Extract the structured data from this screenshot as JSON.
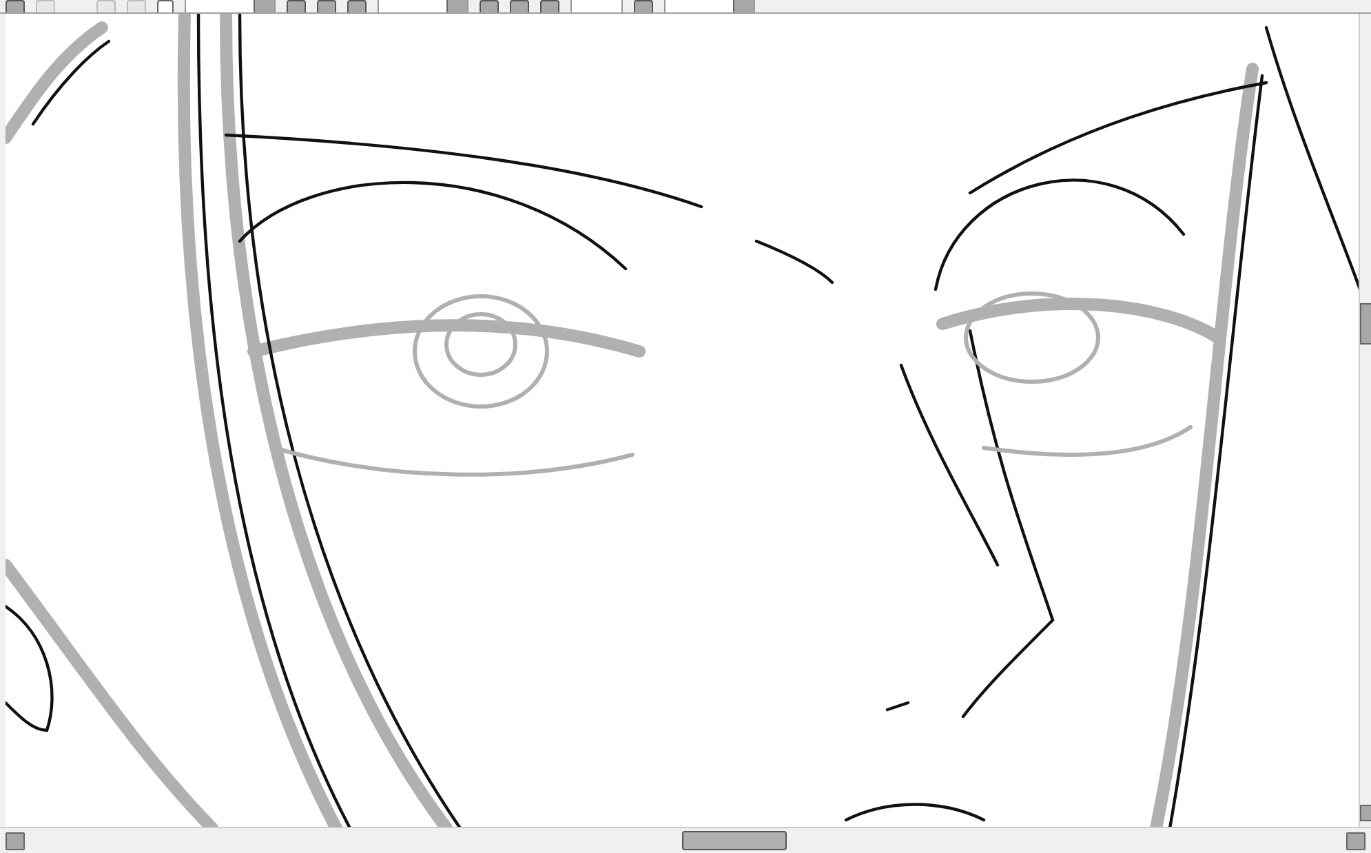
{
  "toolbar": {
    "controls": [
      {
        "kind": "button",
        "disabled": false
      },
      {
        "kind": "button",
        "disabled": true
      },
      {
        "kind": "gap"
      },
      {
        "kind": "button",
        "disabled": true
      },
      {
        "kind": "button",
        "disabled": true
      },
      {
        "kind": "checkbox",
        "checked": false
      },
      {
        "kind": "dropdown"
      },
      {
        "kind": "button",
        "disabled": false
      },
      {
        "kind": "button",
        "disabled": false
      },
      {
        "kind": "button",
        "disabled": false
      },
      {
        "kind": "dropdown"
      },
      {
        "kind": "button",
        "disabled": false
      },
      {
        "kind": "button",
        "disabled": false
      },
      {
        "kind": "button",
        "disabled": false
      },
      {
        "kind": "field"
      },
      {
        "kind": "button",
        "disabled": false
      },
      {
        "kind": "dropdown"
      }
    ]
  },
  "canvas": {
    "kind": "line-art"
  }
}
